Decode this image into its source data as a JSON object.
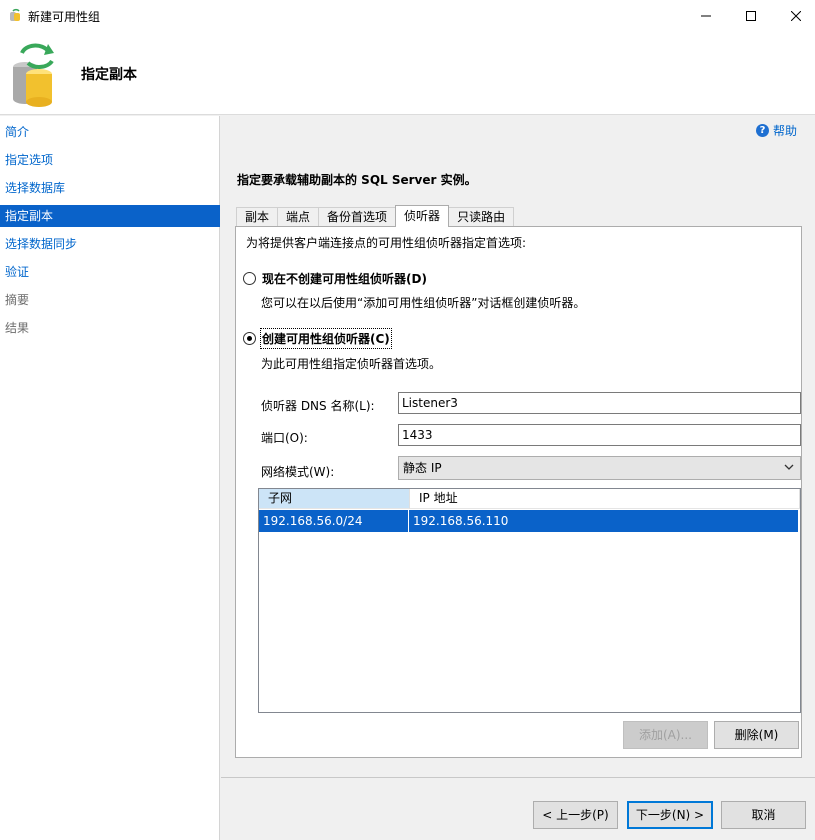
{
  "window": {
    "title": "新建可用性组"
  },
  "header": {
    "page_title": "指定副本"
  },
  "sidebar": {
    "items": [
      {
        "label": "简介",
        "state": "link"
      },
      {
        "label": "指定选项",
        "state": "link"
      },
      {
        "label": "选择数据库",
        "state": "link"
      },
      {
        "label": "指定副本",
        "state": "active"
      },
      {
        "label": "选择数据同步",
        "state": "link"
      },
      {
        "label": "验证",
        "state": "link"
      },
      {
        "label": "摘要",
        "state": "disabled"
      },
      {
        "label": "结果",
        "state": "disabled"
      }
    ]
  },
  "help": {
    "label": "帮助"
  },
  "instruction": "指定要承载辅助副本的 SQL Server 实例。",
  "tabs": [
    {
      "label": "副本"
    },
    {
      "label": "端点"
    },
    {
      "label": "备份首选项"
    },
    {
      "label": "侦听器",
      "active": true
    },
    {
      "label": "只读路由"
    }
  ],
  "listener": {
    "description": "为将提供客户端连接点的可用性组侦听器指定首选项:",
    "option_none": {
      "label": "现在不创建可用性组侦听器(D)",
      "sub": "您可以在以后使用“添加可用性组侦听器”对话框创建侦听器。",
      "checked": false
    },
    "option_create": {
      "label": "创建可用性组侦听器(C)",
      "sub": "为此可用性组指定侦听器首选项。",
      "checked": true
    },
    "dns_label": "侦听器 DNS 名称(L):",
    "dns_value": "Listener3",
    "port_label": "端口(O):",
    "port_value": "1433",
    "network_label": "网络模式(W):",
    "network_value": "静态 IP",
    "grid": {
      "columns": [
        "子网",
        "IP 地址"
      ],
      "rows": [
        [
          "192.168.56.0/24",
          "192.168.56.110"
        ]
      ]
    },
    "add_button": "添加(A)...",
    "remove_button": "删除(M)"
  },
  "footer": {
    "prev_button": "< 上一步(P)",
    "next_button": "下一步(N) >",
    "cancel_button": "取消"
  },
  "colors": {
    "accent": "#0a62c9",
    "link": "#0066cc"
  }
}
